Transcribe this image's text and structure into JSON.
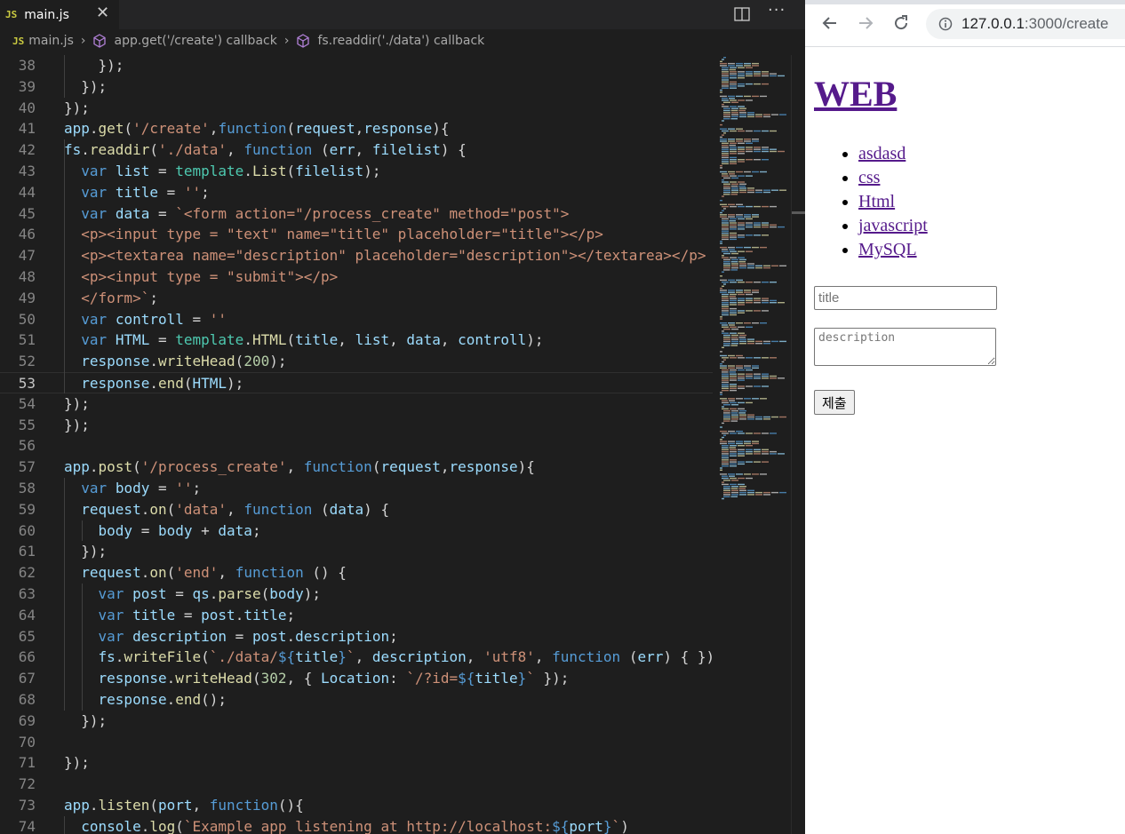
{
  "editor": {
    "tab": {
      "icon": "JS",
      "label": "main.js",
      "close_icon": "close-icon"
    },
    "toolbar": {
      "split_icon": "split-editor-icon",
      "more_icon": "more-actions-icon",
      "more_glyph": "···"
    },
    "breadcrumb": {
      "icon": "JS",
      "file": "main.js",
      "items": [
        "app.get('/create') callback",
        "fs.readdir('./data') callback"
      ]
    },
    "lines": [
      {
        "n": "38",
        "t": "    });"
      },
      {
        "n": "39",
        "t": "  });"
      },
      {
        "n": "40",
        "t": "});"
      },
      {
        "n": "41",
        "t": "app.get('/create',function(request,response){"
      },
      {
        "n": "42",
        "t": "fs.readdir('./data', function (err, filelist) {"
      },
      {
        "n": "43",
        "t": "  var list = template.List(filelist);"
      },
      {
        "n": "44",
        "t": "  var title = '';"
      },
      {
        "n": "45",
        "t": "  var data = `<form action=\"/process_create\" method=\"post\">"
      },
      {
        "n": "46",
        "t": "  <p><input type = \"text\" name=\"title\" placeholder=\"title\"></p>"
      },
      {
        "n": "47",
        "t": "  <p><textarea name=\"description\" placeholder=\"description\"></textarea></p>"
      },
      {
        "n": "48",
        "t": "  <p><input type = \"submit\"></p>"
      },
      {
        "n": "49",
        "t": "  </form>`;"
      },
      {
        "n": "50",
        "t": "  var controll = ''"
      },
      {
        "n": "51",
        "t": "  var HTML = template.HTML(title, list, data, controll);"
      },
      {
        "n": "52",
        "t": "  response.writeHead(200);"
      },
      {
        "n": "53",
        "t": "  response.end(HTML);"
      },
      {
        "n": "54",
        "t": "});"
      },
      {
        "n": "55",
        "t": "});"
      },
      {
        "n": "56",
        "t": ""
      },
      {
        "n": "57",
        "t": "app.post('/process_create', function(request,response){"
      },
      {
        "n": "58",
        "t": "  var body = '';"
      },
      {
        "n": "59",
        "t": "  request.on('data', function (data) {"
      },
      {
        "n": "60",
        "t": "    body = body + data;"
      },
      {
        "n": "61",
        "t": "  });"
      },
      {
        "n": "62",
        "t": "  request.on('end', function () {"
      },
      {
        "n": "63",
        "t": "    var post = qs.parse(body);"
      },
      {
        "n": "64",
        "t": "    var title = post.title;"
      },
      {
        "n": "65",
        "t": "    var description = post.description;"
      },
      {
        "n": "66",
        "t": "    fs.writeFile(`./data/${title}`, description, 'utf8', function (err) { })"
      },
      {
        "n": "67",
        "t": "    response.writeHead(302, { Location: `/?id=${title}` });"
      },
      {
        "n": "68",
        "t": "    response.end();"
      },
      {
        "n": "69",
        "t": "  });"
      },
      {
        "n": "70",
        "t": ""
      },
      {
        "n": "71",
        "t": "});"
      },
      {
        "n": "72",
        "t": ""
      },
      {
        "n": "73",
        "t": "app.listen(port, function(){"
      },
      {
        "n": "74",
        "t": "  console.log(`Example app listening at http://localhost:${port}`)"
      }
    ],
    "colors": {
      "background": "#1e1e1e",
      "keyword": "#569cd6",
      "string": "#ce9178",
      "function": "#dcdcaa",
      "variable": "#9cdcfe",
      "number": "#b5cea8",
      "class": "#4ec9b0"
    }
  },
  "browser": {
    "back_icon": "back-arrow-icon",
    "forward_icon": "forward-arrow-icon",
    "reload_icon": "reload-icon",
    "info_icon": "info-icon",
    "url_host": "127.0.0.1",
    "url_path": ":3000/create",
    "page": {
      "heading": "WEB",
      "files": [
        "asdasd",
        "css",
        "Html",
        "javascript",
        "MySQL"
      ],
      "title_placeholder": "title",
      "description_placeholder": "description",
      "submit_label": "제출",
      "link_color": "#551a8b"
    }
  }
}
